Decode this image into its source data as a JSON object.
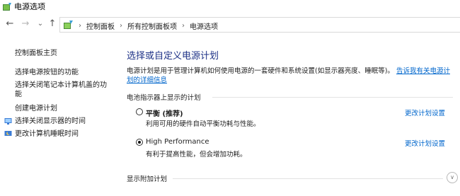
{
  "window": {
    "title": "电源选项",
    "icon": "power-options-icon"
  },
  "nav": {
    "back_icon": "←",
    "forward_icon": "→",
    "recent_icon": "⌄",
    "up_icon": "↑"
  },
  "breadcrumb": {
    "separator": "›",
    "items": [
      {
        "label": "控制面板"
      },
      {
        "label": "所有控制面板项"
      },
      {
        "label": "电源选项"
      }
    ]
  },
  "sidebar": {
    "home_label": "控制面板主页",
    "links": [
      {
        "label": "选择电源按钮的功能",
        "icon": null
      },
      {
        "label": "选择关闭笔记本计算机盖的功\n能",
        "icon": null
      },
      {
        "label": "创建电源计划",
        "icon": null
      },
      {
        "label": "选择关闭显示器的时间",
        "icon": "display-shield-icon"
      },
      {
        "label": "更改计算机睡眠时间",
        "icon": "sleep-moon-icon"
      }
    ]
  },
  "main": {
    "title": "选择或自定义电源计划",
    "description": "电源计划是用于管理计算机如何使用电源的一套硬件和系统设置(如显示器亮度、睡眠等)。",
    "description_link_line1": "告诉我有关电源计",
    "description_link_line2": "划的详细信息",
    "group_heading": "电池指示器上显示的计划",
    "plans": [
      {
        "name": "平衡 (推荐)",
        "description": "利用可用的硬件自动平衡功耗与性能。",
        "link": "更改计划设置",
        "selected": false
      },
      {
        "name": "High Performance",
        "description": "有利于提高性能，但会增加功耗。",
        "link": "更改计划设置",
        "selected": true
      }
    ],
    "additional_heading": "显示附加计划",
    "expand_icon": "∨"
  }
}
